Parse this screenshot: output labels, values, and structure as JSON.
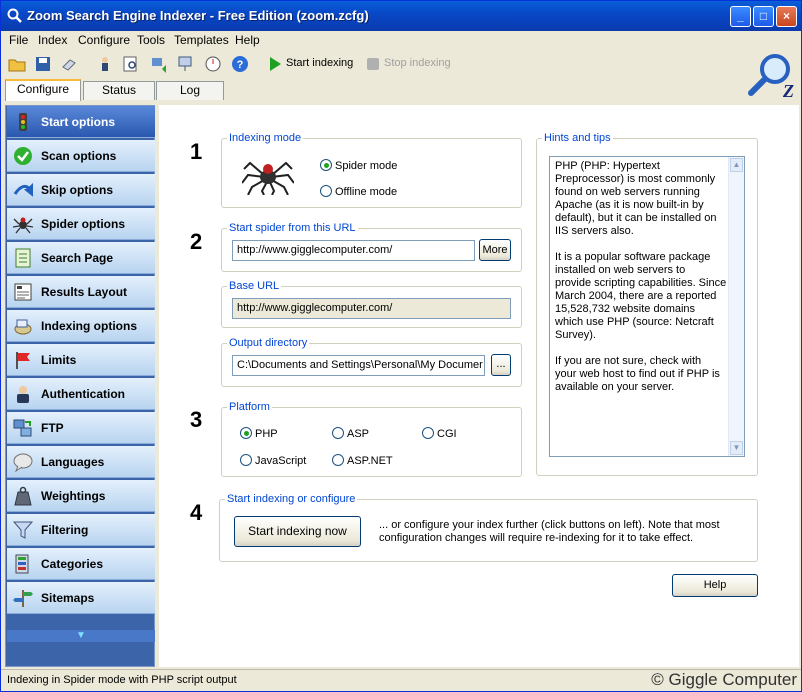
{
  "window": {
    "title": "Zoom Search Engine Indexer - Free Edition (zoom.zcfg)"
  },
  "menu": [
    "File",
    "Index",
    "Configure",
    "Tools",
    "Templates",
    "Help"
  ],
  "toolbar": {
    "start": "Start indexing",
    "stop": "Stop indexing"
  },
  "tabs": [
    {
      "label": "Configure",
      "active": true
    },
    {
      "label": "Status",
      "active": false
    },
    {
      "label": "Log",
      "active": false
    }
  ],
  "sidebar": [
    {
      "label": "Start options",
      "icon": "traffic-light-icon",
      "active": true
    },
    {
      "label": "Scan options",
      "icon": "checkmark-icon",
      "active": false
    },
    {
      "label": "Skip options",
      "icon": "skip-arrow-icon",
      "active": false
    },
    {
      "label": "Spider options",
      "icon": "spider-icon",
      "active": false
    },
    {
      "label": "Search Page",
      "icon": "page-icon",
      "active": false
    },
    {
      "label": "Results Layout",
      "icon": "layout-icon",
      "active": false
    },
    {
      "label": "Indexing options",
      "icon": "index-icon",
      "active": false
    },
    {
      "label": "Limits",
      "icon": "flag-icon",
      "active": false
    },
    {
      "label": "Authentication",
      "icon": "user-icon",
      "active": false
    },
    {
      "label": "FTP",
      "icon": "ftp-icon",
      "active": false
    },
    {
      "label": "Languages",
      "icon": "speech-icon",
      "active": false
    },
    {
      "label": "Weightings",
      "icon": "weight-icon",
      "active": false
    },
    {
      "label": "Filtering",
      "icon": "funnel-icon",
      "active": false
    },
    {
      "label": "Categories",
      "icon": "categories-icon",
      "active": false
    },
    {
      "label": "Sitemaps",
      "icon": "signpost-icon",
      "active": false
    }
  ],
  "steps": {
    "s1": "1",
    "s2": "2",
    "s3": "3",
    "s4": "4"
  },
  "indexing_mode": {
    "label": "Indexing mode",
    "spider": "Spider mode",
    "offline": "Offline mode"
  },
  "start_url": {
    "label": "Start spider from this URL",
    "value": "http://www.gigglecomputer.com/",
    "more": "More"
  },
  "base_url": {
    "label": "Base URL",
    "value": "http://www.gigglecomputer.com/"
  },
  "output_dir": {
    "label": "Output directory",
    "value": "C:\\Documents and Settings\\Personal\\My Documer",
    "browse": "..."
  },
  "platform": {
    "label": "Platform",
    "php": "PHP",
    "asp": "ASP",
    "cgi": "CGI",
    "js": "JavaScript",
    "aspnet": "ASP.NET"
  },
  "start_section": {
    "label": "Start indexing or configure",
    "button": "Start indexing now",
    "text1": "... or configure your index further (click buttons on left). Note that most",
    "text2": "configuration changes will require re-indexing for it to take effect."
  },
  "hints": {
    "label": "Hints and tips",
    "p1": [
      "PHP (PHP: Hypertext",
      "Preprocessor) is most commonly",
      "found on web servers running",
      "Apache (as it is now built-in by",
      "default), but it can be installed on",
      "IIS servers also."
    ],
    "p2": [
      "It is a popular software package",
      "installed on web servers to",
      "provide scripting capabilities. Since",
      "March 2004, there are a reported",
      "15,528,732 website domains",
      "which use PHP (source: Netcraft",
      "Survey)."
    ],
    "p3": [
      "If you are not sure, check with",
      "your web host to find out if PHP is",
      "available on your server."
    ]
  },
  "help_button": "Help",
  "status": {
    "text": "Indexing in Spider mode with PHP script output",
    "copyright": "© Giggle Computer"
  }
}
